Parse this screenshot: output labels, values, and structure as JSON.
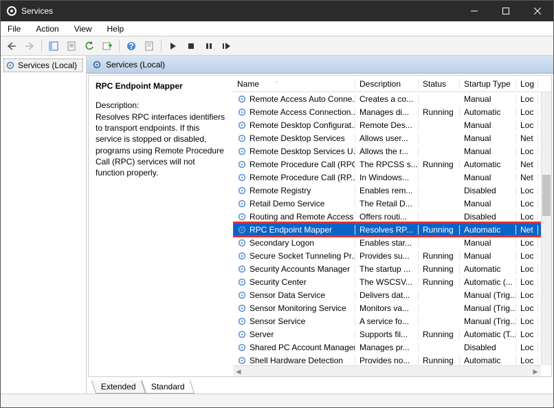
{
  "title": "Services",
  "menu": [
    "File",
    "Action",
    "View",
    "Help"
  ],
  "tree_root": "Services (Local)",
  "header_title": "Services (Local)",
  "selected": {
    "name": "RPC Endpoint Mapper",
    "desc_label": "Description:",
    "description": "Resolves RPC interfaces identifiers to transport endpoints. If this service is stopped or disabled, programs using Remote Procedure Call (RPC) services will not function properly."
  },
  "columns": {
    "name": "Name",
    "desc": "Description",
    "status": "Status",
    "start": "Startup Type",
    "log": "Log"
  },
  "rows": [
    {
      "name": "Remote Access Auto Conne...",
      "desc": "Creates a co...",
      "status": "",
      "start": "Manual",
      "log": "Loc"
    },
    {
      "name": "Remote Access Connection...",
      "desc": "Manages di...",
      "status": "Running",
      "start": "Automatic",
      "log": "Loc"
    },
    {
      "name": "Remote Desktop Configurat...",
      "desc": "Remote Des...",
      "status": "",
      "start": "Manual",
      "log": "Loc"
    },
    {
      "name": "Remote Desktop Services",
      "desc": "Allows user...",
      "status": "",
      "start": "Manual",
      "log": "Net"
    },
    {
      "name": "Remote Desktop Services U...",
      "desc": "Allows the r...",
      "status": "",
      "start": "Manual",
      "log": "Loc"
    },
    {
      "name": "Remote Procedure Call (RPC)",
      "desc": "The RPCSS s...",
      "status": "Running",
      "start": "Automatic",
      "log": "Net"
    },
    {
      "name": "Remote Procedure Call (RP...",
      "desc": "In Windows...",
      "status": "",
      "start": "Manual",
      "log": "Net"
    },
    {
      "name": "Remote Registry",
      "desc": "Enables rem...",
      "status": "",
      "start": "Disabled",
      "log": "Loc"
    },
    {
      "name": "Retail Demo Service",
      "desc": "The Retail D...",
      "status": "",
      "start": "Manual",
      "log": "Loc"
    },
    {
      "name": "Routing and Remote Access",
      "desc": "Offers routi...",
      "status": "",
      "start": "Disabled",
      "log": "Loc"
    },
    {
      "name": "RPC Endpoint Mapper",
      "desc": "Resolves RP...",
      "status": "Running",
      "start": "Automatic",
      "log": "Net",
      "sel": true
    },
    {
      "name": "Secondary Logon",
      "desc": "Enables star...",
      "status": "",
      "start": "Manual",
      "log": "Loc"
    },
    {
      "name": "Secure Socket Tunneling Pr...",
      "desc": "Provides su...",
      "status": "Running",
      "start": "Manual",
      "log": "Loc"
    },
    {
      "name": "Security Accounts Manager",
      "desc": "The startup ...",
      "status": "Running",
      "start": "Automatic",
      "log": "Loc"
    },
    {
      "name": "Security Center",
      "desc": "The WSCSV...",
      "status": "Running",
      "start": "Automatic (...",
      "log": "Loc"
    },
    {
      "name": "Sensor Data Service",
      "desc": "Delivers dat...",
      "status": "",
      "start": "Manual (Trig...",
      "log": "Loc"
    },
    {
      "name": "Sensor Monitoring Service",
      "desc": "Monitors va...",
      "status": "",
      "start": "Manual (Trig...",
      "log": "Loc"
    },
    {
      "name": "Sensor Service",
      "desc": "A service fo...",
      "status": "",
      "start": "Manual (Trig...",
      "log": "Loc"
    },
    {
      "name": "Server",
      "desc": "Supports fil...",
      "status": "Running",
      "start": "Automatic (T...",
      "log": "Loc"
    },
    {
      "name": "Shared PC Account Manager",
      "desc": "Manages pr...",
      "status": "",
      "start": "Disabled",
      "log": "Loc"
    },
    {
      "name": "Shell Hardware Detection",
      "desc": "Provides no...",
      "status": "Running",
      "start": "Automatic",
      "log": "Loc"
    }
  ],
  "tabs": {
    "extended": "Extended",
    "standard": "Standard"
  }
}
